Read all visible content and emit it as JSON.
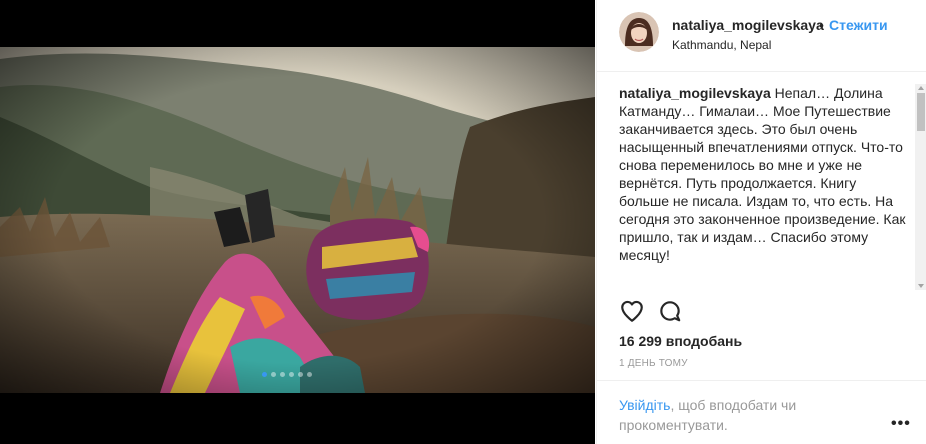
{
  "post": {
    "media_dots": 6,
    "media_active_index": 0
  },
  "header": {
    "username": "nataliya_mogilevskaya",
    "separator": "•",
    "follow_label": "Стежити",
    "location": "Kathmandu, Nepal"
  },
  "caption": {
    "username": "nataliya_mogilevskaya",
    "text": "Непал… Долина Катманду… Гималаи… Мое Путешествие заканчивается здесь. Это был очень насыщенный впечатлениями отпуск. Что-то снова переменилось во мне и уже не вернётся. Путь продолжается. Книгу больше не писала. Издам то, что есть. На сегодня это законченное произведение. Как пришло, так и издам… Спасибо этому месяцу!"
  },
  "actions": {
    "like_icon": "heart-icon",
    "comment_icon": "comment-icon"
  },
  "likes_text": "16 299 вподобань",
  "time_text": "1 ДЕНЬ ТОМУ",
  "footer": {
    "login_link": "Увійдіть",
    "login_rest": ", щоб вподобати чи прокоментувати.",
    "more_label": "•••"
  },
  "colors": {
    "accent": "#3897f0",
    "text": "#262626",
    "muted": "#999999",
    "border": "#efefef"
  }
}
